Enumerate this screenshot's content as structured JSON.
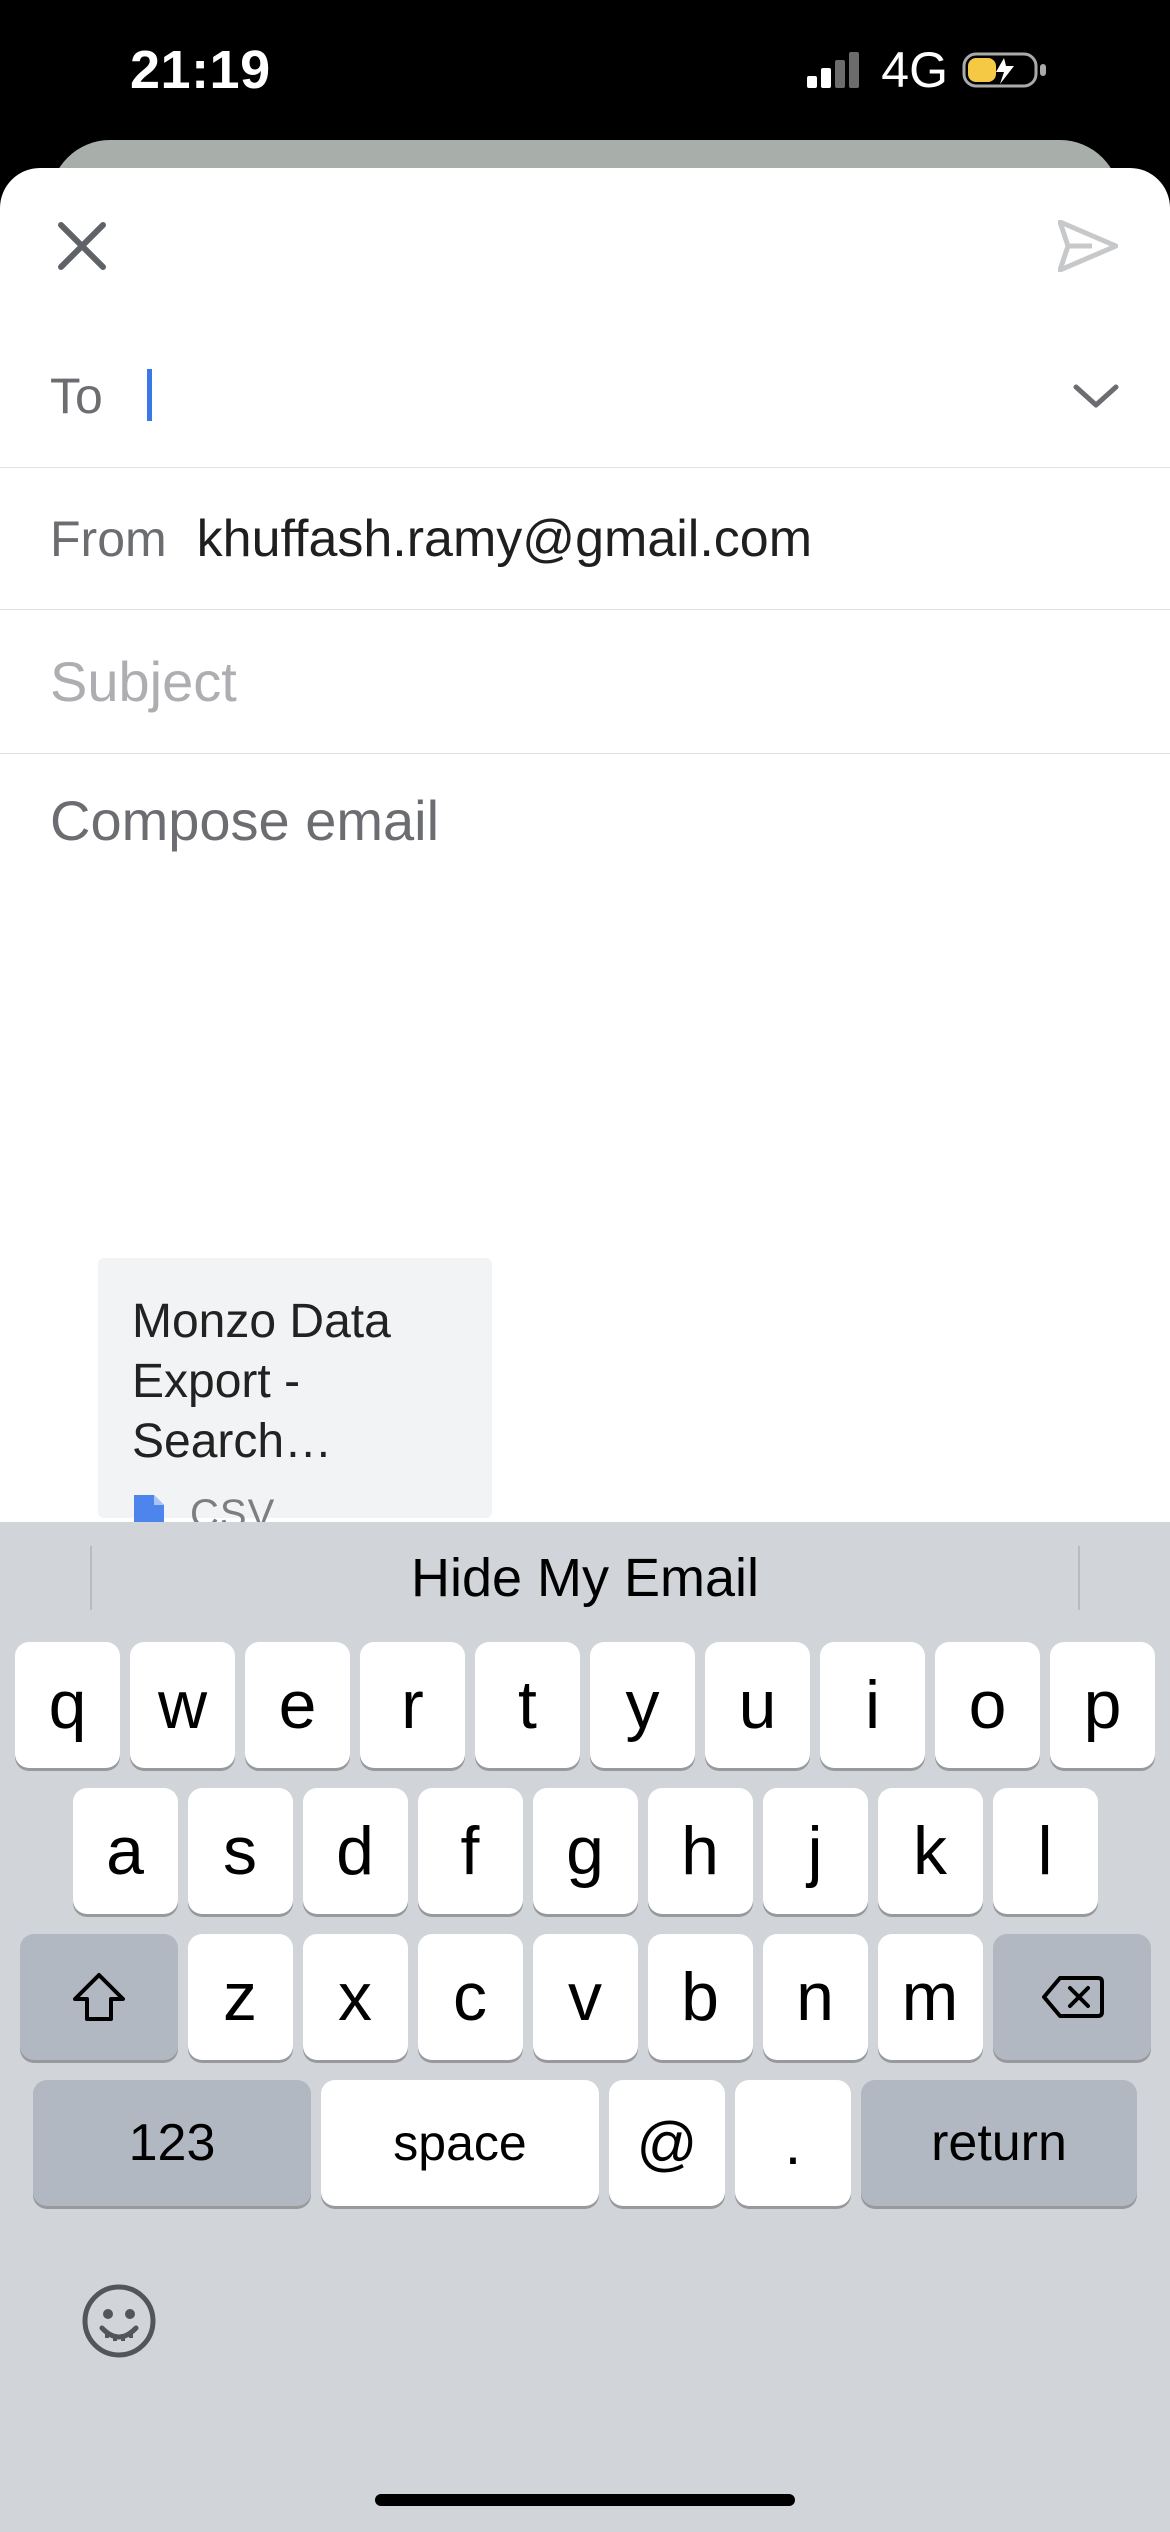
{
  "status_bar": {
    "time": "21:19",
    "network": "4G"
  },
  "compose": {
    "to_label": "To",
    "to_value": "",
    "from_label": "From",
    "from_value": "khuffash.ramy@gmail.com",
    "subject_placeholder": "Subject",
    "body_placeholder": "Compose email"
  },
  "attachment": {
    "title": "Monzo Data\nExport - Search…",
    "extension": "CSV"
  },
  "keyboard": {
    "suggestion": "Hide My Email",
    "row1": [
      "q",
      "w",
      "e",
      "r",
      "t",
      "y",
      "u",
      "i",
      "o",
      "p"
    ],
    "row2": [
      "a",
      "s",
      "d",
      "f",
      "g",
      "h",
      "j",
      "k",
      "l"
    ],
    "row3": [
      "z",
      "x",
      "c",
      "v",
      "b",
      "n",
      "m"
    ],
    "numkey": "123",
    "space": "space",
    "at": "@",
    "dot": ".",
    "return": "return"
  }
}
